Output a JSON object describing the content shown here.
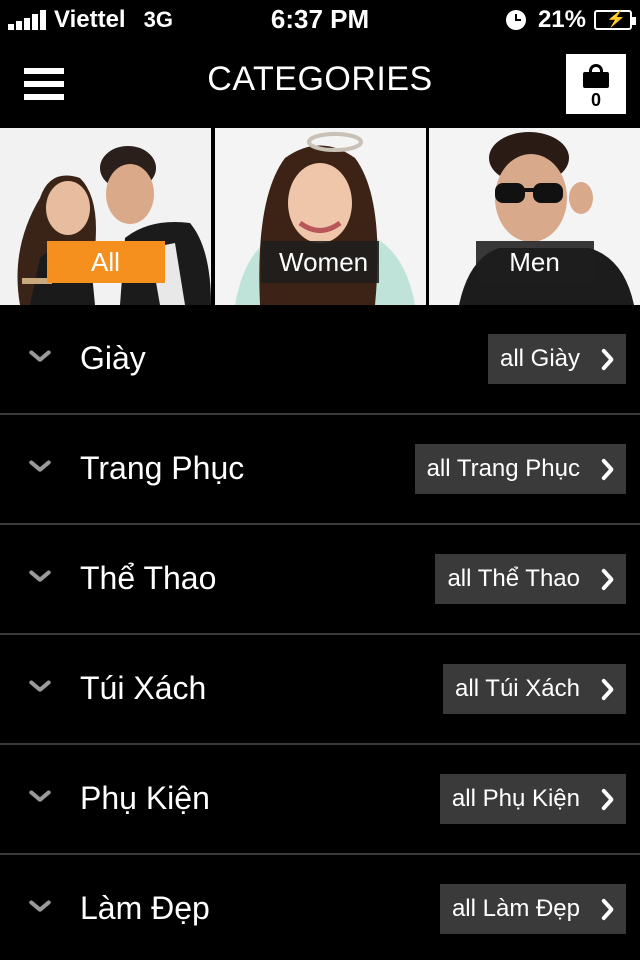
{
  "status_bar": {
    "carrier": "Viettel",
    "network": "3G",
    "time": "6:37 PM",
    "battery": "21%"
  },
  "header": {
    "title": "CATEGORIES",
    "cart_count": "0"
  },
  "tiles": [
    {
      "label": "All",
      "active": true
    },
    {
      "label": "Women",
      "active": false
    },
    {
      "label": "Men",
      "active": false
    }
  ],
  "categories": [
    {
      "name": "Giày",
      "all_label": "all Giày"
    },
    {
      "name": "Trang Phục",
      "all_label": "all Trang Phục"
    },
    {
      "name": "Thể Thao",
      "all_label": "all Thể Thao"
    },
    {
      "name": "Túi Xách",
      "all_label": "all Túi Xách"
    },
    {
      "name": "Phụ Kiện",
      "all_label": "all Phụ Kiện"
    },
    {
      "name": "Làm Đẹp",
      "all_label": "all Làm Đẹp"
    }
  ],
  "colors": {
    "accent": "#f5901e",
    "background": "#000000",
    "button_bg": "#3a3a3a",
    "divider": "#3a3a3a"
  }
}
